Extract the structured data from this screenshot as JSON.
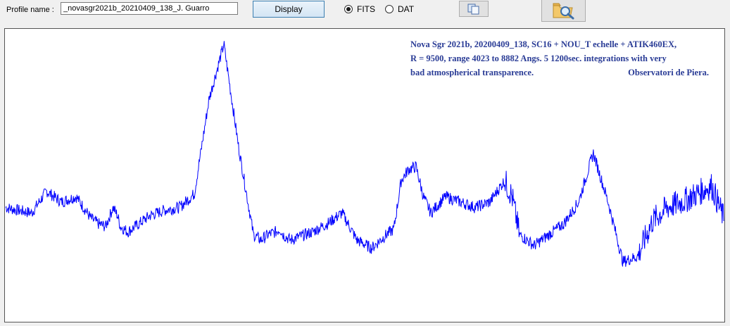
{
  "toolbar": {
    "profile_label": "Profile name :",
    "profile_value": "_novasgr2021b_20210409_138_J. Guarro",
    "display_label": "Display",
    "format_options": [
      {
        "label": "FITS",
        "selected": true
      },
      {
        "label": "DAT",
        "selected": false
      }
    ],
    "copy_icon": "copy-icon",
    "open_icon": "folder-search-icon"
  },
  "annotation": {
    "line1": "Nova Sgr 2021b,  20200409_138,  SC16  +  NOU_T echelle  + ATIK460EX,",
    "line2": "R = 9500, range 4023  to 8882 Angs.  5 1200sec. integrations with very",
    "line3": "bad atmospherical transparence.",
    "observatory": "Observatori de Piera."
  },
  "chart_data": {
    "type": "line",
    "range_angstrom": [
      4023,
      8882
    ],
    "line_color": "#0000ff",
    "grid": false,
    "series": [
      {
        "x": [
          4023,
          4100,
          4200,
          4300,
          4400,
          4500,
          4600,
          4650,
          4700,
          4750,
          4780,
          4800,
          4850,
          4900,
          4950,
          5000,
          5100,
          5200,
          5300,
          5400,
          5500,
          5600,
          5700,
          5750,
          5800,
          5850,
          5880,
          5900,
          5950,
          6000,
          6100,
          6200,
          6300,
          6400,
          6500,
          6600,
          6650,
          6700,
          6750,
          6800,
          6850,
          6900,
          7000,
          7100,
          7200,
          7300,
          7400,
          7450,
          7500,
          7600,
          7700,
          7800,
          7900,
          8000,
          8100,
          8200,
          8300,
          8400,
          8500,
          8600,
          8700,
          8800,
          8882
        ],
        "y": [
          0.4,
          0.39,
          0.38,
          0.46,
          0.42,
          0.44,
          0.36,
          0.34,
          0.33,
          0.4,
          0.37,
          0.33,
          0.31,
          0.33,
          0.35,
          0.37,
          0.39,
          0.4,
          0.45,
          0.8,
          1.0,
          0.62,
          0.3,
          0.28,
          0.3,
          0.31,
          0.32,
          0.3,
          0.28,
          0.29,
          0.31,
          0.34,
          0.38,
          0.28,
          0.25,
          0.3,
          0.32,
          0.5,
          0.54,
          0.55,
          0.44,
          0.38,
          0.44,
          0.42,
          0.4,
          0.42,
          0.5,
          0.44,
          0.3,
          0.26,
          0.3,
          0.34,
          0.42,
          0.6,
          0.42,
          0.2,
          0.22,
          0.35,
          0.4,
          0.42,
          0.45,
          0.48,
          0.36
        ]
      }
    ]
  }
}
